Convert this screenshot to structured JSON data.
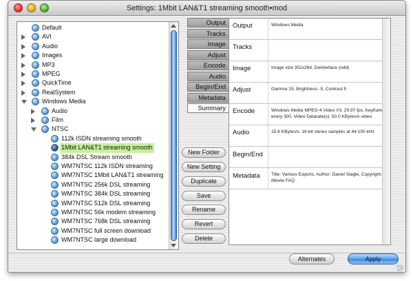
{
  "window": {
    "title": "Settings: 1Mbit LAN&T1 streaming smooth•mod"
  },
  "tree": {
    "items": [
      {
        "label": "Default",
        "level": 0,
        "expander": "none",
        "icon": "globe-icon"
      },
      {
        "label": "AVI",
        "level": 0,
        "expander": "closed",
        "icon": "globe-icon"
      },
      {
        "label": "Audio",
        "level": 0,
        "expander": "closed",
        "icon": "globe-icon"
      },
      {
        "label": "Images",
        "level": 0,
        "expander": "closed",
        "icon": "globe-icon"
      },
      {
        "label": "MP3",
        "level": 0,
        "expander": "closed",
        "icon": "globe-icon"
      },
      {
        "label": "MPEG",
        "level": 0,
        "expander": "closed",
        "icon": "globe-icon"
      },
      {
        "label": "QuickTime",
        "level": 0,
        "expander": "closed",
        "icon": "globe-icon"
      },
      {
        "label": "RealSystem",
        "level": 0,
        "expander": "closed",
        "icon": "globe-icon"
      },
      {
        "label": "Windows Media",
        "level": 0,
        "expander": "open",
        "icon": "globe-icon"
      },
      {
        "label": "Audio",
        "level": 1,
        "expander": "closed",
        "icon": "globe-icon"
      },
      {
        "label": "Film",
        "level": 1,
        "expander": "closed",
        "icon": "globe-icon"
      },
      {
        "label": "NTSC",
        "level": 1,
        "expander": "open",
        "icon": "globe-icon"
      },
      {
        "label": "112k ISDN streaming smooth",
        "level": 2,
        "expander": "none",
        "icon": "globe-icon"
      },
      {
        "label": "1Mbit LAN&T1 streaming smooth",
        "level": 2,
        "expander": "none",
        "icon": "globe-icon",
        "selected": true
      },
      {
        "label": "384k DSL Stream smooth",
        "level": 2,
        "expander": "none",
        "icon": "globe-icon"
      },
      {
        "label": "WM7NTSC 112k ISDN streaming",
        "level": 2,
        "expander": "none",
        "icon": "globe-icon"
      },
      {
        "label": "WM7NTSC 1Mbit LAN&T1 streaming",
        "level": 2,
        "expander": "none",
        "icon": "globe-icon"
      },
      {
        "label": "WM7NTSC 256k DSL streaming",
        "level": 2,
        "expander": "none",
        "icon": "globe-icon"
      },
      {
        "label": "WM7NTSC 384k DSL streaming",
        "level": 2,
        "expander": "none",
        "icon": "globe-icon"
      },
      {
        "label": "WM7NTSC 512k DSL streaming",
        "level": 2,
        "expander": "none",
        "icon": "globe-icon"
      },
      {
        "label": "WM7NTSC 56k modem streaming",
        "level": 2,
        "expander": "none",
        "icon": "globe-icon"
      },
      {
        "label": "WM7NTSC 768k DSL streaming",
        "level": 2,
        "expander": "none",
        "icon": "globe-icon"
      },
      {
        "label": "WM7NTSC full screen download",
        "level": 2,
        "expander": "none",
        "icon": "globe-icon"
      },
      {
        "label": "WM7NTSC large download",
        "level": 2,
        "expander": "none",
        "icon": "globe-icon"
      }
    ]
  },
  "actions": {
    "new_folder": "New Folder",
    "new_setting": "New Setting",
    "duplicate": "Duplicate",
    "save": "Save",
    "rename": "Rename",
    "revert": "Revert",
    "delete": "Delete"
  },
  "tabs": [
    "Output",
    "Tracks",
    "Image",
    "Adjust",
    "Encode",
    "Audio",
    "Begin/End",
    "Metadata",
    "Summary"
  ],
  "active_tab": "Summary",
  "summary": [
    {
      "key": "Output",
      "value": "Windows Media"
    },
    {
      "key": "Tracks",
      "value": ""
    },
    {
      "key": "Image",
      "value": "Image size 352x264, Deinterlace (odd)"
    },
    {
      "key": "Adjust",
      "value": "Gamma 15, Brightness -5, Contrast 5"
    },
    {
      "key": "Encode",
      "value": "Windows Media MPEG-4 Video V3, 29.97 fps, Keyframe every 300, Video Datarate(s): 50.0 KBytes/s video"
    },
    {
      "key": "Audio",
      "value": "15.6 KBytes/s, 16-bit stereo samples at 44.100 kHz"
    },
    {
      "key": "Begin/End",
      "value": ""
    },
    {
      "key": "Metadata",
      "value": "Title: Various Exports, Author: Daniel Slagle, Copyright: iMovie FAQ"
    }
  ],
  "footer": {
    "alternates": "Alternates",
    "apply": "Apply"
  },
  "colors": {
    "selection": "#c6f09a",
    "accent": "#3c86dc"
  }
}
